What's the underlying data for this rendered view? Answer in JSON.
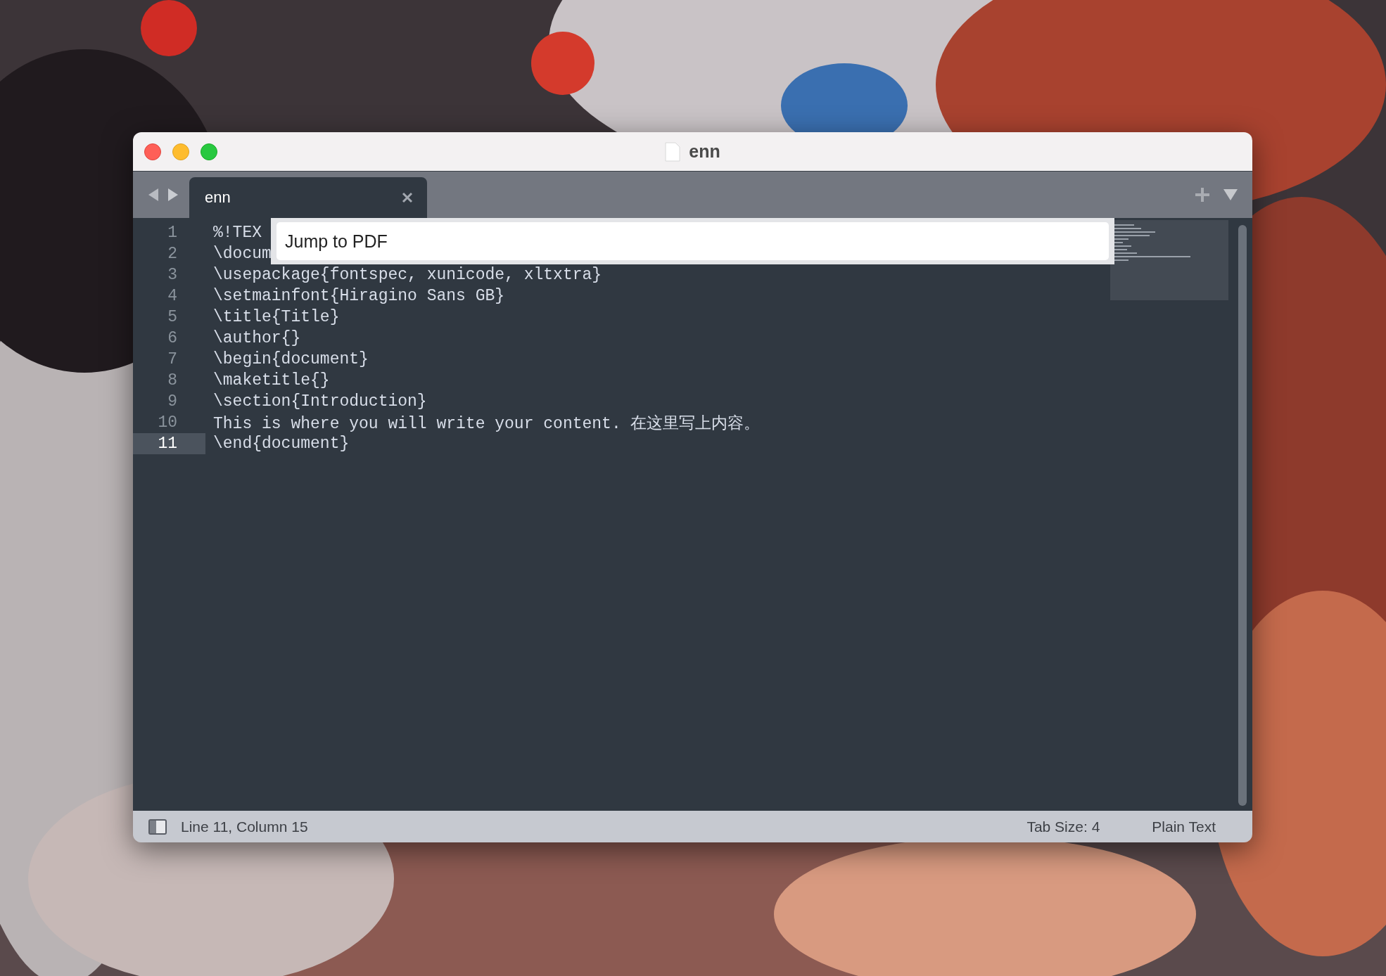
{
  "window": {
    "title": "enn"
  },
  "tabs": [
    {
      "label": "enn",
      "selected": true
    }
  ],
  "editor": {
    "lines": [
      {
        "number": "1",
        "text": "%!TEX",
        "current": false
      },
      {
        "number": "2",
        "text": "\\docum",
        "current": false
      },
      {
        "number": "3",
        "text": "\\usepackage{fontspec, xunicode, xltxtra}",
        "current": false
      },
      {
        "number": "4",
        "text": "\\setmainfont{Hiragino Sans GB}",
        "current": false
      },
      {
        "number": "5",
        "text": "\\title{Title}",
        "current": false
      },
      {
        "number": "6",
        "text": "\\author{}",
        "current": false
      },
      {
        "number": "7",
        "text": "\\begin{document}",
        "current": false
      },
      {
        "number": "8",
        "text": "\\maketitle{}",
        "current": false
      },
      {
        "number": "9",
        "text": "\\section{Introduction}",
        "current": false
      },
      {
        "number": "10",
        "text": "This is where you will write your content. 在这里写上内容。",
        "current": false
      },
      {
        "number": "11",
        "text": "\\end{document}",
        "current": true
      }
    ]
  },
  "command_panel": {
    "value": "Jump to PDF"
  },
  "status_bar": {
    "position": "Line 11, Column 15",
    "tab_size": "Tab Size: 4",
    "syntax": "Plain Text"
  }
}
